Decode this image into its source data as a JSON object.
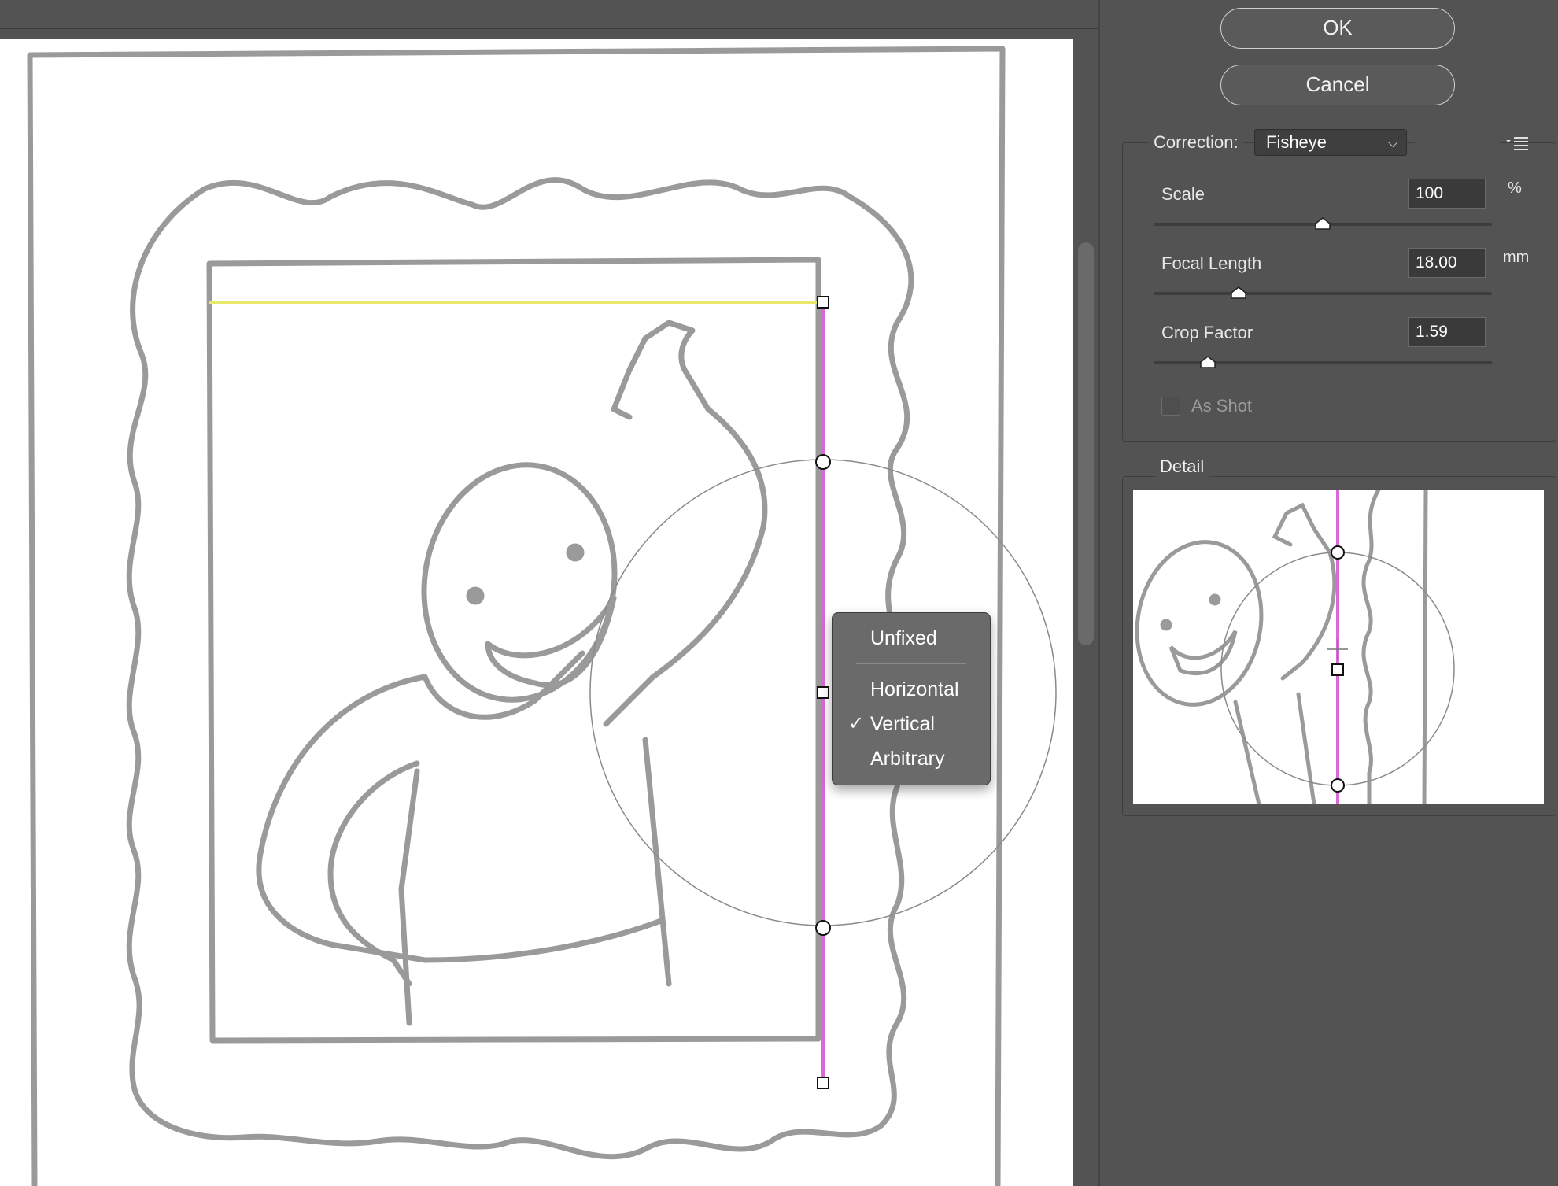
{
  "dialog": {
    "ok_label": "OK",
    "cancel_label": "Cancel"
  },
  "correction": {
    "label": "Correction:",
    "selected": "Fisheye"
  },
  "params": {
    "scale": {
      "label": "Scale",
      "value": "100",
      "unit": "%",
      "slider_fraction": 0.5
    },
    "focal_length": {
      "label": "Focal Length",
      "value": "18.00",
      "unit": "mm",
      "slider_fraction": 0.25
    },
    "crop_factor": {
      "label": "Crop Factor",
      "value": "1.59",
      "slider_fraction": 0.16
    },
    "as_shot": {
      "label": "As Shot",
      "checked": false
    }
  },
  "detail": {
    "legend": "Detail"
  },
  "constraint_menu": {
    "items": [
      {
        "label": "Unfixed",
        "checked": false
      },
      {
        "label": "Horizontal",
        "checked": false
      },
      {
        "label": "Vertical",
        "checked": true
      },
      {
        "label": "Arbitrary",
        "checked": false
      }
    ]
  },
  "colors": {
    "panel_bg": "#535353",
    "constraint_vertical": "#d86ad8",
    "constraint_horizontal": "#e8e86a",
    "sketch_stroke": "#9a9a9a"
  },
  "icons": {
    "checkmark": "checkmark-icon",
    "panel_menu": "panel-menu-icon",
    "dropdown": "chevron-down-icon"
  }
}
